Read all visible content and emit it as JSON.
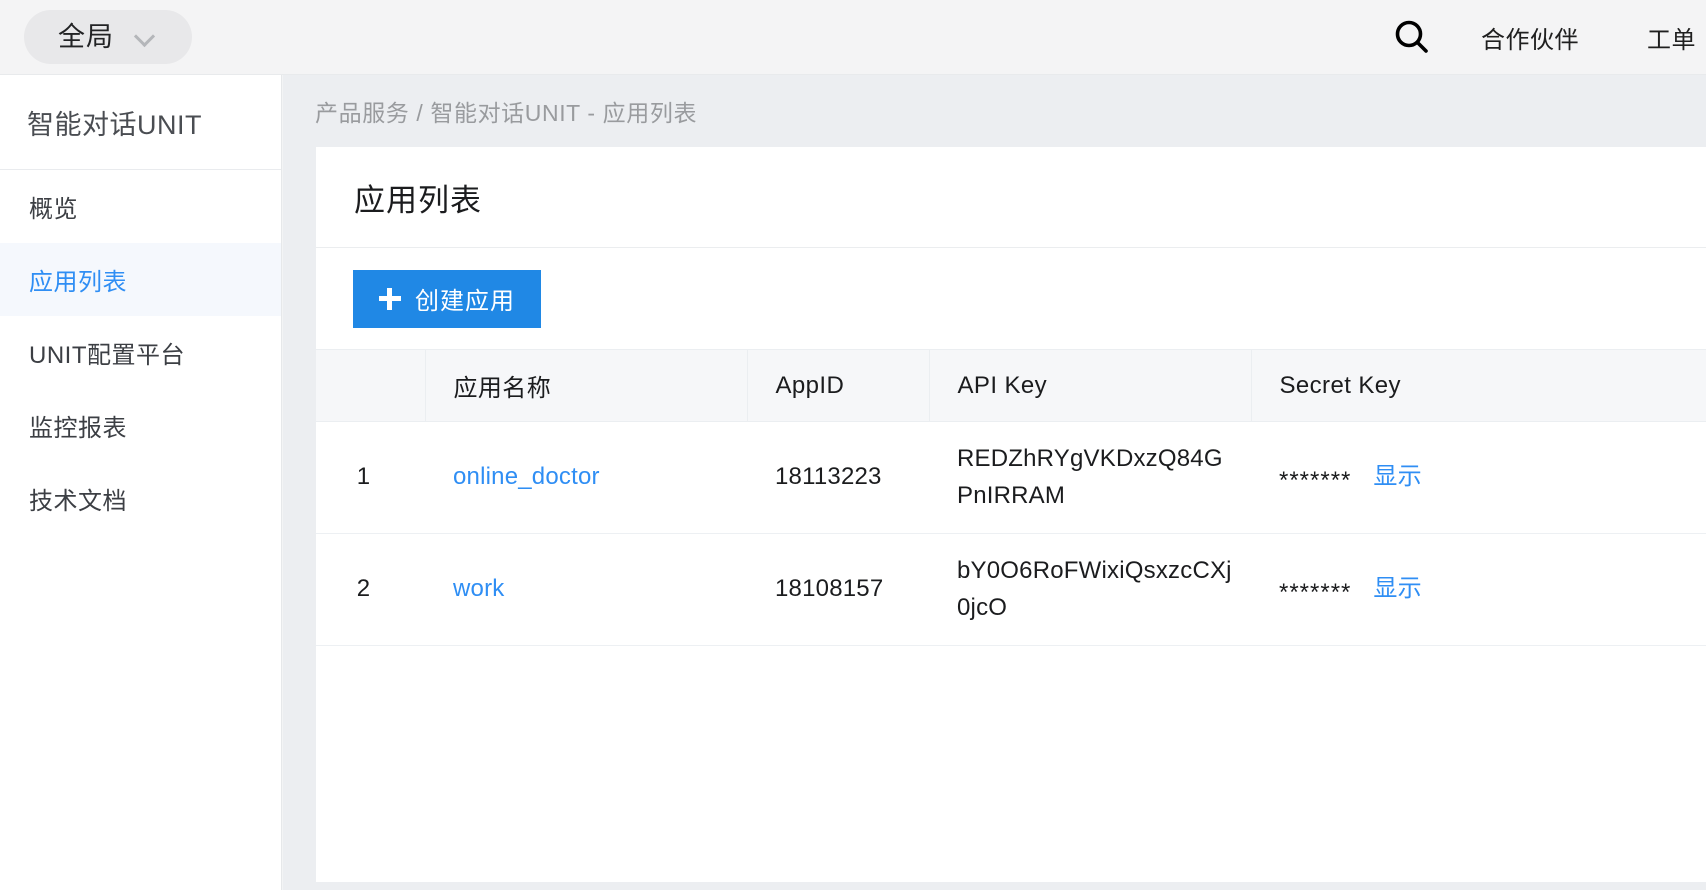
{
  "header": {
    "scope_selector": {
      "label": "全局",
      "icon": "chevron-down-icon"
    },
    "search_icon": "search-icon",
    "links": [
      {
        "label": "合作伙伴"
      },
      {
        "label": "工单"
      }
    ]
  },
  "sidebar": {
    "title": "智能对话UNIT",
    "items": [
      {
        "label": "概览",
        "active": false
      },
      {
        "label": "应用列表",
        "active": true
      },
      {
        "label": "UNIT配置平台",
        "active": false
      },
      {
        "label": "监控报表",
        "active": false
      },
      {
        "label": "技术文档",
        "active": false
      }
    ]
  },
  "main": {
    "breadcrumb": "产品服务 / 智能对话UNIT - 应用列表",
    "card_title": "应用列表",
    "create_button": {
      "label": "创建应用",
      "icon": "plus-icon"
    },
    "table": {
      "columns": [
        "",
        "应用名称",
        "AppID",
        "API Key",
        "Secret Key"
      ],
      "rows": [
        {
          "index": "1",
          "name": "online_doctor",
          "appid": "18113223",
          "api_key": "REDZhRYgVKDxzQ84GPnIRRAM",
          "secret_mask": "*******",
          "secret_action": "显示"
        },
        {
          "index": "2",
          "name": "work",
          "appid": "18108157",
          "api_key": "bY0O6RoFWixiQsxzcCXj0jcO",
          "secret_mask": "*******",
          "secret_action": "显示"
        }
      ]
    }
  },
  "colors": {
    "accent": "#2f8ef4",
    "button": "#2088e5",
    "page_bg": "#eceef1",
    "header_bg": "#f4f4f5",
    "table_header_bg": "#f6f7f9"
  }
}
